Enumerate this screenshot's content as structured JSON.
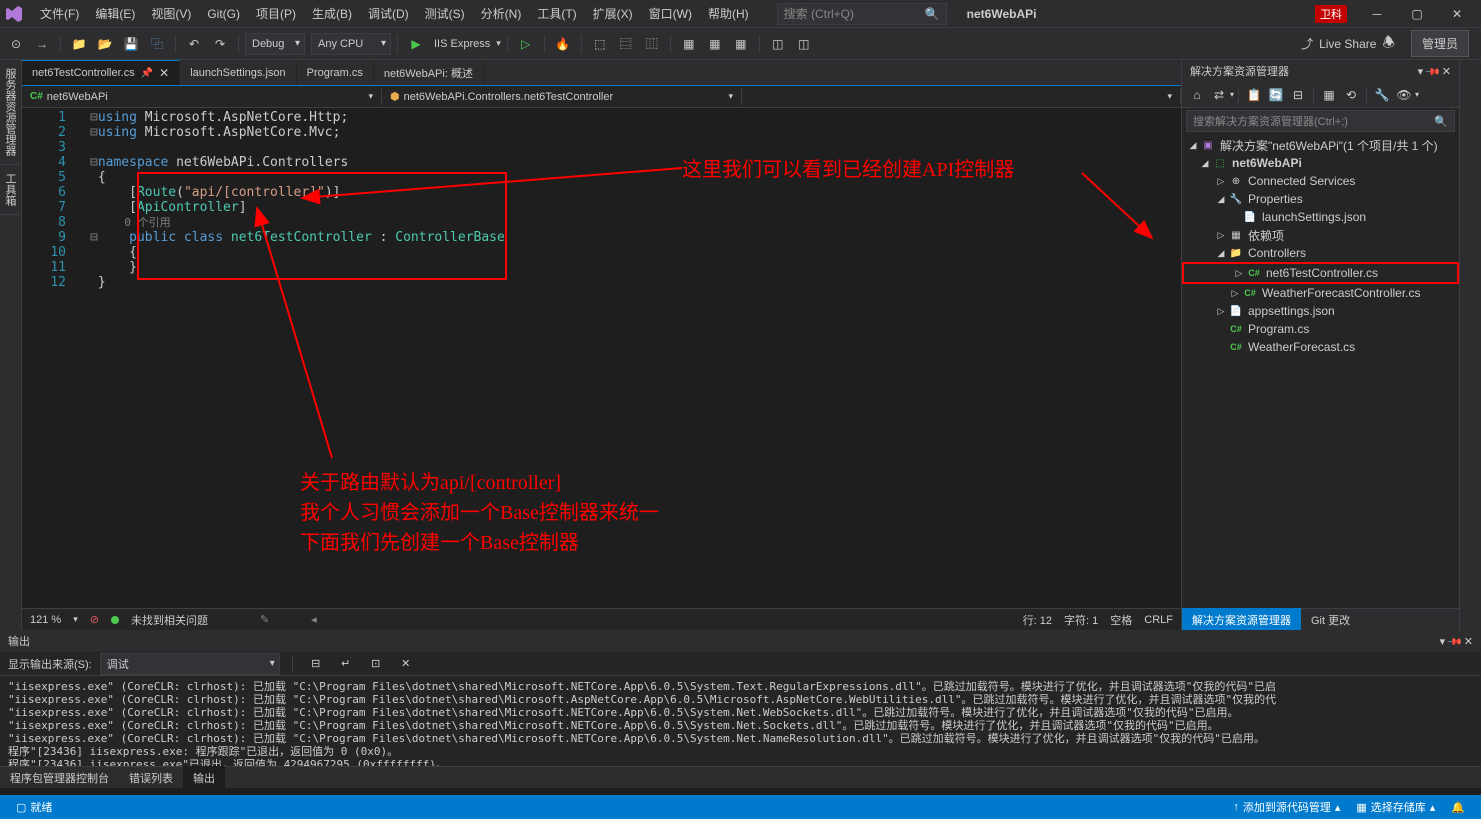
{
  "titlebar": {
    "menus": [
      "文件(F)",
      "编辑(E)",
      "视图(V)",
      "Git(G)",
      "项目(P)",
      "生成(B)",
      "调试(D)",
      "测试(S)",
      "分析(N)",
      "工具(T)",
      "扩展(X)",
      "窗口(W)",
      "帮助(H)"
    ],
    "search_placeholder": "搜索 (Ctrl+Q)",
    "app_title": "net6WebAPi",
    "badge": "卫科"
  },
  "toolbar": {
    "config": "Debug",
    "platform": "Any CPU",
    "run_target": "IIS Express",
    "live_share": "Live Share",
    "admin": "管理员"
  },
  "left_sidebar_tabs": [
    "服务器资源管理器",
    "工具箱"
  ],
  "doc_tabs": [
    {
      "label": "net6TestController.cs",
      "active": true,
      "pinned": true
    },
    {
      "label": "launchSettings.json",
      "active": false
    },
    {
      "label": "Program.cs",
      "active": false
    },
    {
      "label": "net6WebAPi: 概述",
      "active": false
    }
  ],
  "breadcrumb": {
    "left": "net6WebAPi",
    "mid": "net6WebAPi.Controllers.net6TestController",
    "right": ""
  },
  "code": {
    "lines": [
      {
        "n": 1,
        "segs": [
          {
            "t": "using ",
            "c": "kw"
          },
          {
            "t": "Microsoft.AspNetCore.Http;",
            "c": ""
          }
        ]
      },
      {
        "n": 2,
        "segs": [
          {
            "t": "using ",
            "c": "kw"
          },
          {
            "t": "Microsoft.AspNetCore.Mvc;",
            "c": ""
          }
        ]
      },
      {
        "n": 3,
        "segs": []
      },
      {
        "n": 4,
        "segs": [
          {
            "t": "namespace ",
            "c": "kw"
          },
          {
            "t": "net6WebAPi.Controllers",
            "c": ""
          }
        ]
      },
      {
        "n": 5,
        "segs": [
          {
            "t": "{",
            "c": ""
          }
        ]
      },
      {
        "n": 6,
        "segs": [
          {
            "t": "    [",
            "c": ""
          },
          {
            "t": "Route",
            "c": "cls"
          },
          {
            "t": "(",
            "c": ""
          },
          {
            "t": "\"api/[controller]\"",
            "c": "str"
          },
          {
            "t": ")]",
            "c": ""
          }
        ]
      },
      {
        "n": 7,
        "segs": [
          {
            "t": "    [",
            "c": ""
          },
          {
            "t": "ApiController",
            "c": "cls"
          },
          {
            "t": "]",
            "c": ""
          }
        ]
      },
      {
        "n": "7a",
        "hint": true,
        "segs": [
          {
            "t": "    0 个引用",
            "c": "ref-hint"
          }
        ]
      },
      {
        "n": 8,
        "segs": [
          {
            "t": "    ",
            "c": ""
          },
          {
            "t": "public class ",
            "c": "kw"
          },
          {
            "t": "net6TestController",
            "c": "cls"
          },
          {
            "t": " : ",
            "c": ""
          },
          {
            "t": "ControllerBase",
            "c": "cls"
          }
        ]
      },
      {
        "n": 9,
        "segs": [
          {
            "t": "    {",
            "c": ""
          }
        ]
      },
      {
        "n": 10,
        "segs": [
          {
            "t": "    }",
            "c": ""
          }
        ]
      },
      {
        "n": 11,
        "segs": [
          {
            "t": "}",
            "c": ""
          }
        ]
      },
      {
        "n": 12,
        "segs": []
      }
    ]
  },
  "annotations": {
    "top_right": "这里我们可以看到已经创建API控制器",
    "mid": [
      "关于路由默认为api/[controller]",
      "我个人习惯会添加一个Base控制器来统一",
      "下面我们先创建一个Base控制器"
    ]
  },
  "editor_status": {
    "zoom": "121 %",
    "issues": "未找到相关问题",
    "pos_line": "行: 12",
    "pos_char": "字符: 1",
    "space": "空格",
    "eol": "CRLF"
  },
  "output": {
    "title": "输出",
    "source_label": "显示输出来源(S):",
    "source_value": "调试",
    "lines": [
      "\"iisexpress.exe\" (CoreCLR: clrhost): 已加载 \"C:\\Program Files\\dotnet\\shared\\Microsoft.NETCore.App\\6.0.5\\System.Text.RegularExpressions.dll\"。已跳过加载符号。模块进行了优化，并且调试器选项\"仅我的代码\"已启",
      "\"iisexpress.exe\" (CoreCLR: clrhost): 已加载 \"C:\\Program Files\\dotnet\\shared\\Microsoft.AspNetCore.App\\6.0.5\\Microsoft.AspNetCore.WebUtilities.dll\"。已跳过加载符号。模块进行了优化，并且调试器选项\"仅我的代",
      "\"iisexpress.exe\" (CoreCLR: clrhost): 已加载 \"C:\\Program Files\\dotnet\\shared\\Microsoft.NETCore.App\\6.0.5\\System.Net.WebSockets.dll\"。已跳过加载符号。模块进行了优化，并且调试器选项\"仅我的代码\"已启用。",
      "\"iisexpress.exe\" (CoreCLR: clrhost): 已加载 \"C:\\Program Files\\dotnet\\shared\\Microsoft.NETCore.App\\6.0.5\\System.Net.Sockets.dll\"。已跳过加载符号。模块进行了优化，并且调试器选项\"仅我的代码\"已启用。",
      "\"iisexpress.exe\" (CoreCLR: clrhost): 已加载 \"C:\\Program Files\\dotnet\\shared\\Microsoft.NETCore.App\\6.0.5\\System.Net.NameResolution.dll\"。已跳过加载符号。模块进行了优化，并且调试器选项\"仅我的代码\"已启用。",
      "程序\"[23436] iisexpress.exe: 程序跟踪\"已退出，返回值为 0 (0x0)。",
      "程序\"[23436] iisexpress.exe\"已退出，返回值为 4294967295 (0xffffffff)。"
    ]
  },
  "output_tabs": [
    "程序包管理器控制台",
    "错误列表",
    "输出"
  ],
  "solution": {
    "title": "解决方案资源管理器",
    "search_placeholder": "搜索解决方案资源管理器(Ctrl+;)",
    "root": "解决方案\"net6WebAPi\"(1 个项目/共 1 个)",
    "project": "net6WebAPi",
    "tree": [
      {
        "indent": 2,
        "arrow": "▷",
        "icon": "⊕",
        "label": "Connected Services"
      },
      {
        "indent": 2,
        "arrow": "◢",
        "icon": "🔧",
        "label": "Properties"
      },
      {
        "indent": 3,
        "arrow": "",
        "icon": "📄",
        "label": "launchSettings.json"
      },
      {
        "indent": 2,
        "arrow": "▷",
        "icon": "▦",
        "label": "依赖项"
      },
      {
        "indent": 2,
        "arrow": "◢",
        "icon": "📁",
        "label": "Controllers"
      },
      {
        "indent": 3,
        "arrow": "▷",
        "icon": "C#",
        "label": "net6TestController.cs",
        "highlighted": true
      },
      {
        "indent": 3,
        "arrow": "▷",
        "icon": "C#",
        "label": "WeatherForecastController.cs"
      },
      {
        "indent": 2,
        "arrow": "▷",
        "icon": "📄",
        "label": "appsettings.json"
      },
      {
        "indent": 2,
        "arrow": "",
        "icon": "C#",
        "label": "Program.cs"
      },
      {
        "indent": 2,
        "arrow": "",
        "icon": "C#",
        "label": "WeatherForecast.cs"
      }
    ],
    "bottom_tabs": [
      "解决方案资源管理器",
      "Git 更改"
    ]
  },
  "status_bar": {
    "ready": "就绪",
    "src_ctrl": "添加到源代码管理",
    "repo": "选择存储库"
  }
}
